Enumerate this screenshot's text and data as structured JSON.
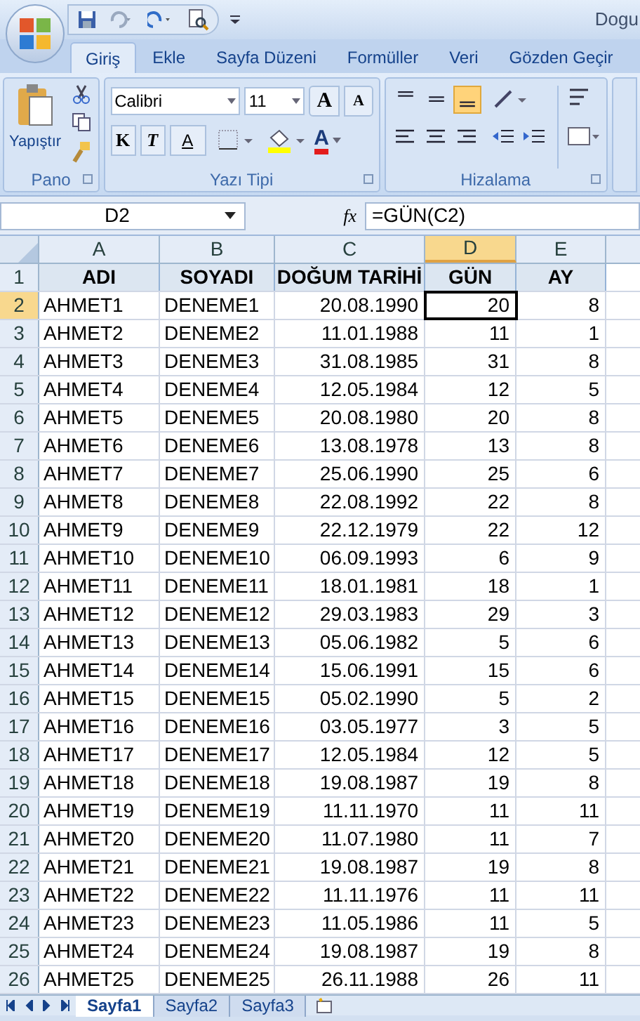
{
  "window": {
    "title": "Dogu"
  },
  "tabs": [
    {
      "label": "Giriş",
      "selected": true
    },
    {
      "label": "Ekle",
      "selected": false
    },
    {
      "label": "Sayfa Düzeni",
      "selected": false
    },
    {
      "label": "Formüller",
      "selected": false
    },
    {
      "label": "Veri",
      "selected": false
    },
    {
      "label": "Gözden Geçir",
      "selected": false
    }
  ],
  "ribbon": {
    "clipboard": {
      "paste_label": "Yapıştır",
      "group_label": "Pano"
    },
    "font": {
      "font_name": "Calibri",
      "font_size": "11",
      "grow_glyph": "A",
      "shrink_glyph": "A",
      "bold_glyph": "K",
      "italic_glyph": "T",
      "underline_glyph": "A",
      "font_color_glyph": "A",
      "group_label": "Yazı Tipi"
    },
    "alignment": {
      "group_label": "Hizalama",
      "vertical_buttons": [
        {
          "kind": "top",
          "selected": false
        },
        {
          "kind": "middle",
          "selected": false
        },
        {
          "kind": "bottom",
          "selected": true
        }
      ]
    }
  },
  "formula_bar": {
    "name_box": "D2",
    "fx_label": "fx",
    "formula": "=GÜN(C2)"
  },
  "sheet": {
    "columns": [
      {
        "label": "A",
        "selected": false
      },
      {
        "label": "B",
        "selected": false
      },
      {
        "label": "C",
        "selected": false
      },
      {
        "label": "D",
        "selected": true
      },
      {
        "label": "E",
        "selected": false
      }
    ],
    "header_row": {
      "number": "1",
      "cells": [
        "ADI",
        "SOYADI",
        "DOĞUM TARİHİ",
        "GÜN",
        "AY"
      ]
    },
    "rows": [
      {
        "number": "2",
        "selected": true,
        "cells": [
          "AHMET1",
          "DENEME1",
          "20.08.1990",
          "20",
          "8"
        ]
      },
      {
        "number": "3",
        "selected": false,
        "cells": [
          "AHMET2",
          "DENEME2",
          "11.01.1988",
          "11",
          "1"
        ]
      },
      {
        "number": "4",
        "selected": false,
        "cells": [
          "AHMET3",
          "DENEME3",
          "31.08.1985",
          "31",
          "8"
        ]
      },
      {
        "number": "5",
        "selected": false,
        "cells": [
          "AHMET4",
          "DENEME4",
          "12.05.1984",
          "12",
          "5"
        ]
      },
      {
        "number": "6",
        "selected": false,
        "cells": [
          "AHMET5",
          "DENEME5",
          "20.08.1980",
          "20",
          "8"
        ]
      },
      {
        "number": "7",
        "selected": false,
        "cells": [
          "AHMET6",
          "DENEME6",
          "13.08.1978",
          "13",
          "8"
        ]
      },
      {
        "number": "8",
        "selected": false,
        "cells": [
          "AHMET7",
          "DENEME7",
          "25.06.1990",
          "25",
          "6"
        ]
      },
      {
        "number": "9",
        "selected": false,
        "cells": [
          "AHMET8",
          "DENEME8",
          "22.08.1992",
          "22",
          "8"
        ]
      },
      {
        "number": "10",
        "selected": false,
        "cells": [
          "AHMET9",
          "DENEME9",
          "22.12.1979",
          "22",
          "12"
        ]
      },
      {
        "number": "11",
        "selected": false,
        "cells": [
          "AHMET10",
          "DENEME10",
          "06.09.1993",
          "6",
          "9"
        ]
      },
      {
        "number": "12",
        "selected": false,
        "cells": [
          "AHMET11",
          "DENEME11",
          "18.01.1981",
          "18",
          "1"
        ]
      },
      {
        "number": "13",
        "selected": false,
        "cells": [
          "AHMET12",
          "DENEME12",
          "29.03.1983",
          "29",
          "3"
        ]
      },
      {
        "number": "14",
        "selected": false,
        "cells": [
          "AHMET13",
          "DENEME13",
          "05.06.1982",
          "5",
          "6"
        ]
      },
      {
        "number": "15",
        "selected": false,
        "cells": [
          "AHMET14",
          "DENEME14",
          "15.06.1991",
          "15",
          "6"
        ]
      },
      {
        "number": "16",
        "selected": false,
        "cells": [
          "AHMET15",
          "DENEME15",
          "05.02.1990",
          "5",
          "2"
        ]
      },
      {
        "number": "17",
        "selected": false,
        "cells": [
          "AHMET16",
          "DENEME16",
          "03.05.1977",
          "3",
          "5"
        ]
      },
      {
        "number": "18",
        "selected": false,
        "cells": [
          "AHMET17",
          "DENEME17",
          "12.05.1984",
          "12",
          "5"
        ]
      },
      {
        "number": "19",
        "selected": false,
        "cells": [
          "AHMET18",
          "DENEME18",
          "19.08.1987",
          "19",
          "8"
        ]
      },
      {
        "number": "20",
        "selected": false,
        "cells": [
          "AHMET19",
          "DENEME19",
          "11.11.1970",
          "11",
          "11"
        ]
      },
      {
        "number": "21",
        "selected": false,
        "cells": [
          "AHMET20",
          "DENEME20",
          "11.07.1980",
          "11",
          "7"
        ]
      },
      {
        "number": "22",
        "selected": false,
        "cells": [
          "AHMET21",
          "DENEME21",
          "19.08.1987",
          "19",
          "8"
        ]
      },
      {
        "number": "23",
        "selected": false,
        "cells": [
          "AHMET22",
          "DENEME22",
          "11.11.1976",
          "11",
          "11"
        ]
      },
      {
        "number": "24",
        "selected": false,
        "cells": [
          "AHMET23",
          "DENEME23",
          "11.05.1986",
          "11",
          "5"
        ]
      },
      {
        "number": "25",
        "selected": false,
        "cells": [
          "AHMET24",
          "DENEME24",
          "19.08.1987",
          "19",
          "8"
        ]
      },
      {
        "number": "26",
        "selected": false,
        "cells": [
          "AHMET25",
          "DENEME25",
          "26.11.1988",
          "26",
          "11"
        ]
      }
    ]
  },
  "sheet_tabs": [
    {
      "label": "Sayfa1",
      "selected": true
    },
    {
      "label": "Sayfa2",
      "selected": false
    },
    {
      "label": "Sayfa3",
      "selected": false
    }
  ]
}
